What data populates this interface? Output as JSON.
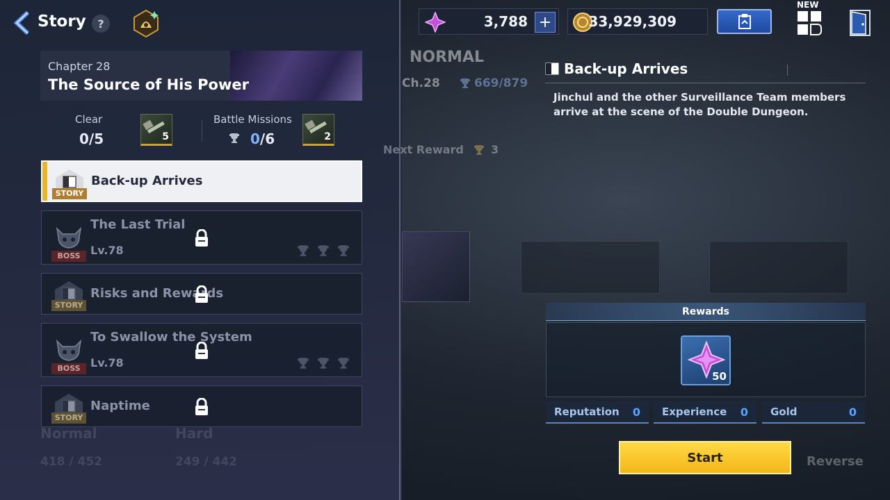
{
  "header": {
    "title": "Story",
    "help_label": "?",
    "gem_amount": "3,788",
    "plus_label": "+",
    "gold_amount": "33,929,309",
    "new_badge": "NEW"
  },
  "chapter": {
    "number": "Chapter 28",
    "name": "The Source of His Power",
    "clear_label": "Clear",
    "clear_value": "0/5",
    "clear_reward_count": "5",
    "missions_label": "Battle Missions",
    "missions_done": "0",
    "missions_total": "/6",
    "missions_reward_count": "2"
  },
  "quests": [
    {
      "title": "Back-up Arrives",
      "tag": "STORY",
      "state": "active"
    },
    {
      "title": "The Last Trial",
      "tag": "BOSS",
      "level": "Lv.78",
      "state": "locked"
    },
    {
      "title": "Risks and Rewards",
      "tag": "STORY",
      "state": "locked"
    },
    {
      "title": "To Swallow the System",
      "tag": "BOSS",
      "level": "Lv.78",
      "state": "locked"
    },
    {
      "title": "Naptime",
      "tag": "STORY",
      "state": "locked"
    }
  ],
  "background": {
    "mode": "NORMAL",
    "chapter": "Ch.28",
    "trophies": "669/879",
    "next_reward": "Next Reward",
    "next_reward_count": "3",
    "normal_label": "Normal",
    "normal_value": "418 / 452",
    "hard_label": "Hard",
    "hard_value": "249 / 442",
    "reverse_label": "Reverse"
  },
  "detail": {
    "title": "Back-up Arrives",
    "description": "Jinchul and the other Surveillance Team members arrive at the scene of the Double Dungeon.",
    "rewards_label": "Rewards",
    "reward_count": "50",
    "reputation_label": "Reputation",
    "reputation_value": "0",
    "experience_label": "Experience",
    "experience_value": "0",
    "gold_label": "Gold",
    "gold_value": "0",
    "start_label": "Start"
  },
  "colors": {
    "accent_gold": "#f3b619",
    "accent_blue": "#3469c9",
    "active_highlight": "#e8b62a",
    "value_blue": "#5aa2ff"
  }
}
